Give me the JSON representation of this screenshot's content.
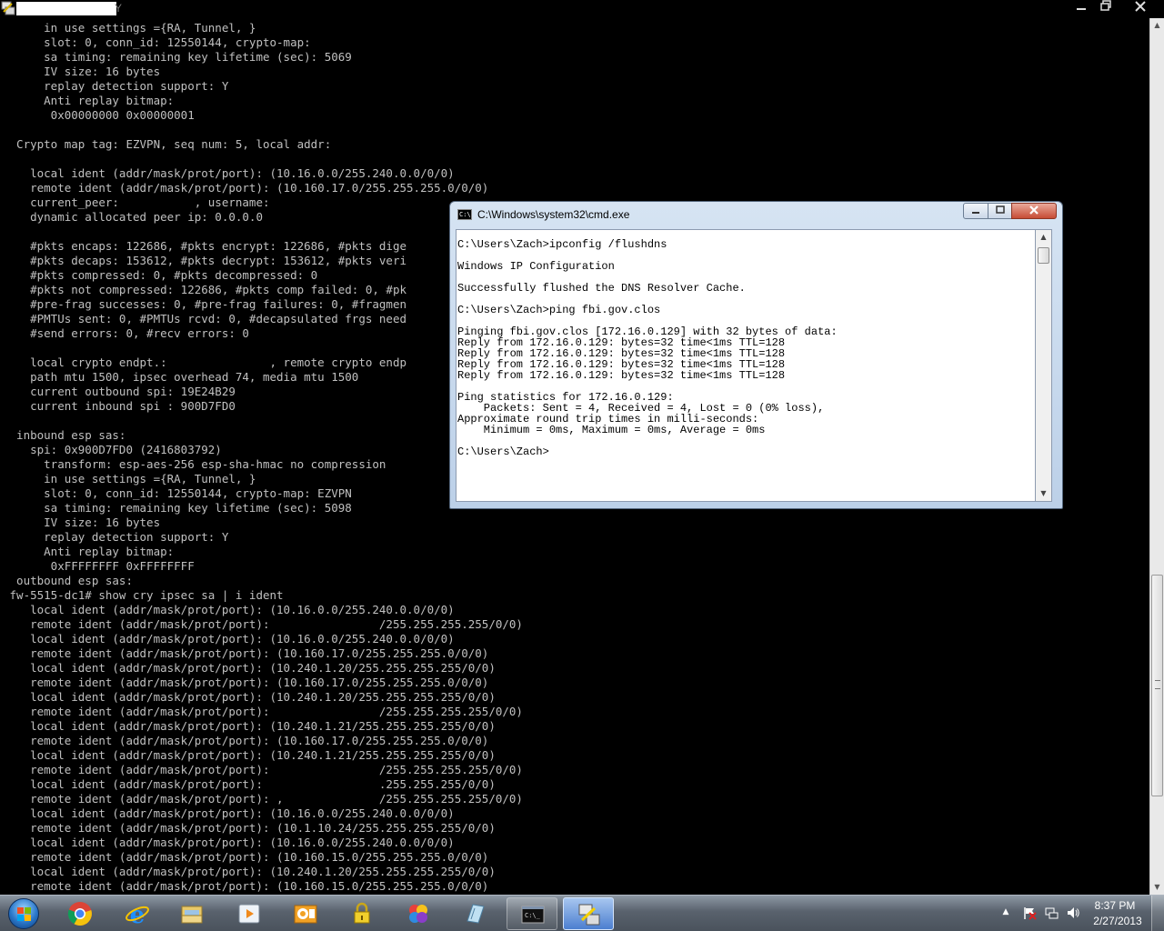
{
  "outer_window": {
    "title_tail": "Y",
    "terminal_lines": [
      "      in use settings ={RA, Tunnel, }",
      "      slot: 0, conn_id: 12550144, crypto-map:",
      "      sa timing: remaining key lifetime (sec): 5069",
      "      IV size: 16 bytes",
      "      replay detection support: Y",
      "      Anti replay bitmap:",
      "       0x00000000 0x00000001",
      "",
      "  Crypto map tag: EZVPN, seq num: 5, local addr:",
      "",
      "    local ident (addr/mask/prot/port): (10.16.0.0/255.240.0.0/0/0)",
      "    remote ident (addr/mask/prot/port): (10.160.17.0/255.255.255.0/0/0)",
      "    current_peer:           , username:",
      "    dynamic allocated peer ip: 0.0.0.0",
      "",
      "    #pkts encaps: 122686, #pkts encrypt: 122686, #pkts dige",
      "    #pkts decaps: 153612, #pkts decrypt: 153612, #pkts veri",
      "    #pkts compressed: 0, #pkts decompressed: 0",
      "    #pkts not compressed: 122686, #pkts comp failed: 0, #pk",
      "    #pre-frag successes: 0, #pre-frag failures: 0, #fragmen",
      "    #PMTUs sent: 0, #PMTUs rcvd: 0, #decapsulated frgs need",
      "    #send errors: 0, #recv errors: 0",
      "",
      "    local crypto endpt.:               , remote crypto endp",
      "    path mtu 1500, ipsec overhead 74, media mtu 1500",
      "    current outbound spi: 19E24B29",
      "    current inbound spi : 900D7FD0",
      "",
      "  inbound esp sas:",
      "    spi: 0x900D7FD0 (2416803792)",
      "      transform: esp-aes-256 esp-sha-hmac no compression",
      "      in use settings ={RA, Tunnel, }",
      "      slot: 0, conn_id: 12550144, crypto-map: EZVPN",
      "      sa timing: remaining key lifetime (sec): 5098",
      "      IV size: 16 bytes",
      "      replay detection support: Y",
      "      Anti replay bitmap:",
      "       0xFFFFFFFF 0xFFFFFFFF",
      "  outbound esp sas:",
      " fw-5515-dc1# show cry ipsec sa | i ident",
      "    local ident (addr/mask/prot/port): (10.16.0.0/255.240.0.0/0/0)",
      "    remote ident (addr/mask/prot/port):                /255.255.255.255/0/0)",
      "    local ident (addr/mask/prot/port): (10.16.0.0/255.240.0.0/0/0)",
      "    remote ident (addr/mask/prot/port): (10.160.17.0/255.255.255.0/0/0)",
      "    local ident (addr/mask/prot/port): (10.240.1.20/255.255.255.255/0/0)",
      "    remote ident (addr/mask/prot/port): (10.160.17.0/255.255.255.0/0/0)",
      "    local ident (addr/mask/prot/port): (10.240.1.20/255.255.255.255/0/0)",
      "    remote ident (addr/mask/prot/port):                /255.255.255.255/0/0)",
      "    local ident (addr/mask/prot/port): (10.240.1.21/255.255.255.255/0/0)",
      "    remote ident (addr/mask/prot/port): (10.160.17.0/255.255.255.0/0/0)",
      "    local ident (addr/mask/prot/port): (10.240.1.21/255.255.255.255/0/0)",
      "    remote ident (addr/mask/prot/port):                /255.255.255.255/0/0)",
      "    local ident (addr/mask/prot/port):                 .255.255.255/0/0)",
      "    remote ident (addr/mask/prot/port): ,              /255.255.255.255/0/0)",
      "    local ident (addr/mask/prot/port): (10.16.0.0/255.240.0.0/0/0)",
      "    remote ident (addr/mask/prot/port): (10.1.10.24/255.255.255.255/0/0)",
      "    local ident (addr/mask/prot/port): (10.16.0.0/255.240.0.0/0/0)",
      "    remote ident (addr/mask/prot/port): (10.160.15.0/255.255.255.0/0/0)",
      "    local ident (addr/mask/prot/port): (10.240.1.20/255.255.255.255/0/0)",
      "    remote ident (addr/mask/prot/port): (10.160.15.0/255.255.255.0/0/0)"
    ]
  },
  "cmd_window": {
    "title": "C:\\Windows\\system32\\cmd.exe",
    "lines": [
      {
        "text": "C:\\Users\\Zach>ipconfig /flushdns",
        "gap": false
      },
      {
        "text": "Windows IP Configuration",
        "gap": true
      },
      {
        "text": "Successfully flushed the DNS Resolver Cache.",
        "gap": true
      },
      {
        "text": "C:\\Users\\Zach>ping fbi.gov.clos",
        "gap": true
      },
      {
        "text": "Pinging fbi.gov.clos [172.16.0.129] with 32 bytes of data:",
        "gap": true
      },
      {
        "text": "Reply from 172.16.0.129: bytes=32 time<1ms TTL=128",
        "gap": false
      },
      {
        "text": "Reply from 172.16.0.129: bytes=32 time<1ms TTL=128",
        "gap": false
      },
      {
        "text": "Reply from 172.16.0.129: bytes=32 time<1ms TTL=128",
        "gap": false
      },
      {
        "text": "Reply from 172.16.0.129: bytes=32 time<1ms TTL=128",
        "gap": false
      },
      {
        "text": "Ping statistics for 172.16.0.129:",
        "gap": true
      },
      {
        "text": "    Packets: Sent = 4, Received = 4, Lost = 0 (0% loss),",
        "gap": false
      },
      {
        "text": "Approximate round trip times in milli-seconds:",
        "gap": false
      },
      {
        "text": "    Minimum = 0ms, Maximum = 0ms, Average = 0ms",
        "gap": false
      },
      {
        "text": "C:\\Users\\Zach>",
        "gap": true
      }
    ]
  },
  "taskbar": {
    "items": [
      {
        "name": "chrome",
        "icon": "chrome-icon",
        "state": "normal"
      },
      {
        "name": "internet-explorer",
        "icon": "internet-explorer-icon",
        "state": "normal"
      },
      {
        "name": "file-explorer",
        "icon": "folder-icon",
        "state": "normal"
      },
      {
        "name": "media-player",
        "icon": "media-player-icon",
        "state": "normal"
      },
      {
        "name": "outlook",
        "icon": "outlook-icon",
        "state": "normal"
      },
      {
        "name": "keychain",
        "icon": "lock-key-icon",
        "state": "normal"
      },
      {
        "name": "paint",
        "icon": "paint-palette-icon",
        "state": "normal"
      },
      {
        "name": "notepad",
        "icon": "notebook-icon",
        "state": "normal"
      },
      {
        "name": "cmd",
        "icon": "cmd-icon",
        "state": "open"
      },
      {
        "name": "putty",
        "icon": "putty-icon",
        "state": "active"
      }
    ],
    "tray": {
      "icons": [
        "action-center-flag-icon",
        "network-icon",
        "volume-icon"
      ],
      "time": "8:37 PM",
      "date": "2/27/2013"
    }
  },
  "colors": {
    "terminal_bg": "#000000",
    "terminal_fg": "#c0c0c0",
    "cmd_bg": "#ffffff",
    "cmd_fg": "#000000",
    "taskbar": "#59626d"
  }
}
